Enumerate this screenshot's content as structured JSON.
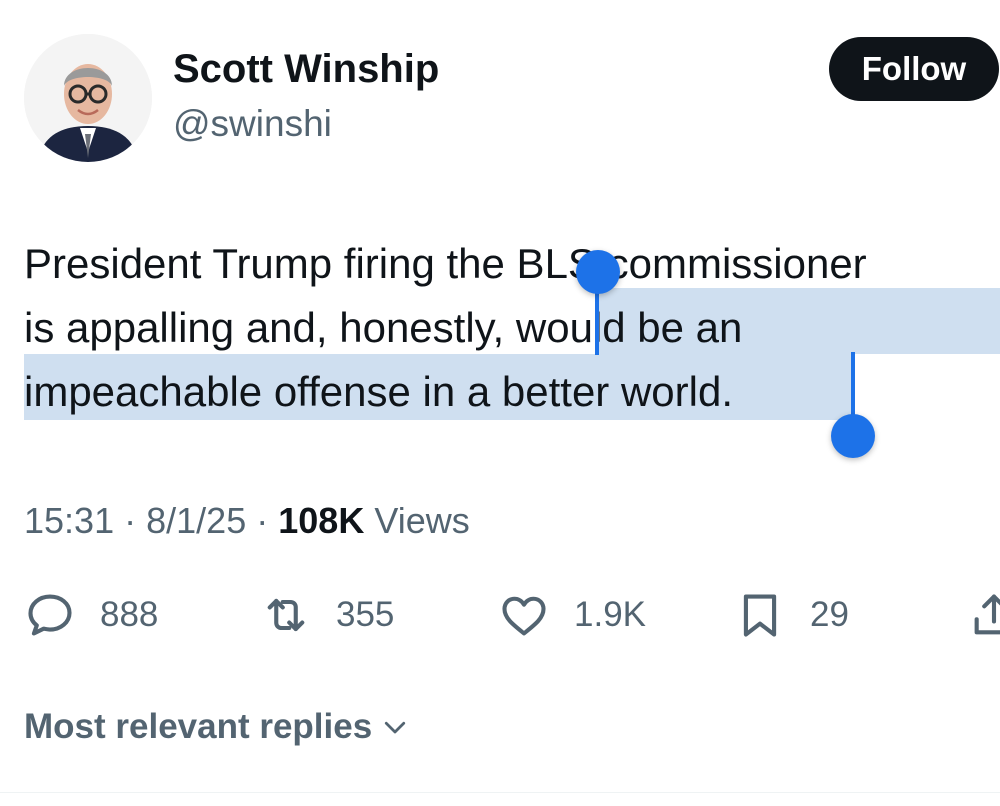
{
  "author": {
    "name": "Scott Winship",
    "handle": "@swinshi",
    "follow_label": "Follow"
  },
  "tweet": {
    "line1": "President Trump firing the BLS commissioner",
    "line2_unselected": "is appalling and, honestly, ",
    "line2_selected": "would be an",
    "line3_selected": "impeachable offense in a better world."
  },
  "meta": {
    "time": "15:31",
    "date": "8/1/25",
    "views_count": "108K",
    "views_label": "Views",
    "separator": "·"
  },
  "actions": {
    "replies": "888",
    "reposts": "355",
    "likes": "1.9K",
    "bookmarks": "29"
  },
  "replies_sort": {
    "label": "Most relevant replies"
  },
  "colors": {
    "selection_bg": "#cfdff0",
    "selection_handle": "#1d72e8",
    "text_primary": "#0f1419",
    "text_secondary": "#536471"
  }
}
